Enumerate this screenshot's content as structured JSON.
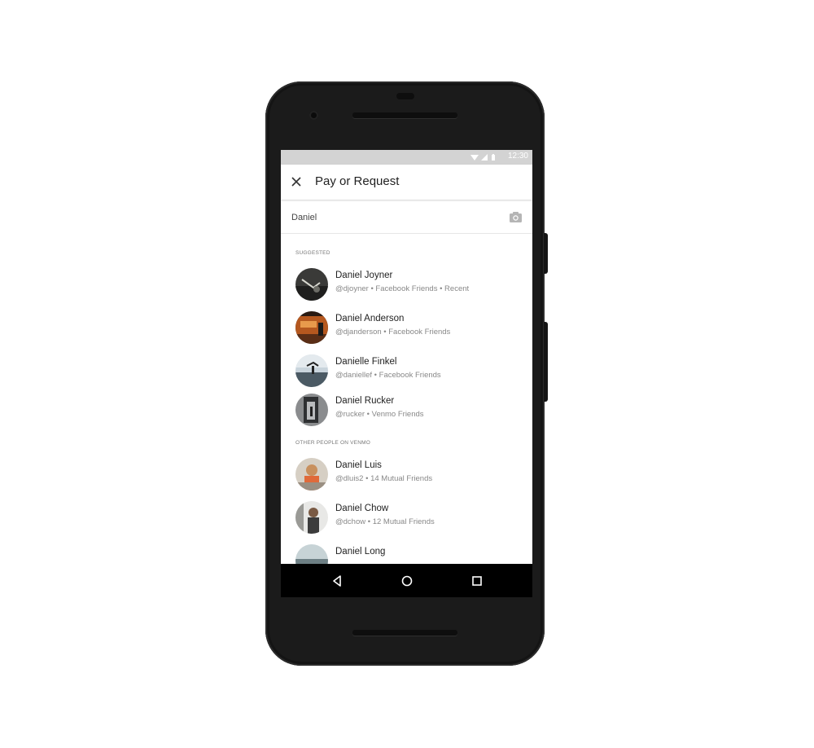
{
  "status_bar": {
    "time": "12:30"
  },
  "app_bar": {
    "title": "Pay or Request",
    "close_icon": "close-icon"
  },
  "search": {
    "value": "Daniel",
    "camera_icon": "camera-icon"
  },
  "sections": {
    "suggested": "SUGGESTED",
    "other": "OTHER PEOPLE ON VENMO"
  },
  "suggested": [
    {
      "name": "Daniel Joyner",
      "sub": "@djoyner • Facebook Friends • Recent"
    },
    {
      "name": "Daniel Anderson",
      "sub": "@djanderson  • Facebook Friends"
    },
    {
      "name": "Danielle Finkel",
      "sub": "@daniellef  • Facebook Friends"
    },
    {
      "name": "Daniel Rucker",
      "sub": "@rucker  • Venmo Friends"
    }
  ],
  "other": [
    {
      "name": "Daniel Luis",
      "sub": "@dluis2  • 14 Mutual Friends"
    },
    {
      "name": "Daniel Chow",
      "sub": "@dchow  • 12 Mutual Friends"
    },
    {
      "name": "Daniel Long",
      "sub": ""
    }
  ],
  "nav": {
    "back_icon": "back-triangle-icon",
    "home_icon": "home-circle-icon",
    "recents_icon": "recents-square-icon"
  }
}
